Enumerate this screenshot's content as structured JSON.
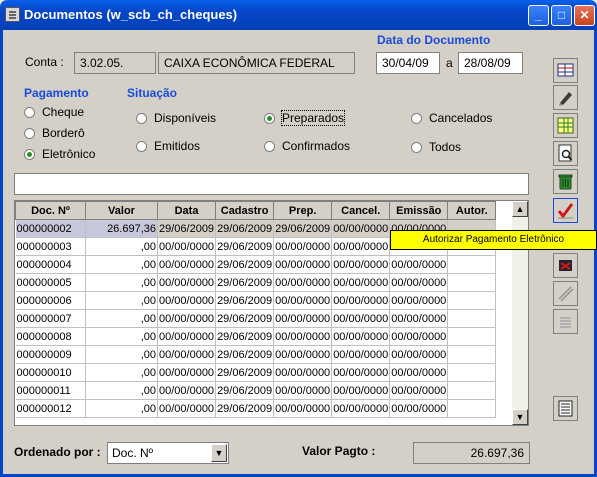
{
  "window": {
    "title": "Documentos (w_scb_ch_cheques)",
    "minimize": "_",
    "maximize": "□",
    "close": "✕"
  },
  "conta": {
    "label": "Conta :",
    "code": "3.02.05.",
    "name": "CAIXA ECONÔMICA FEDERAL"
  },
  "data_documento": {
    "label": "Data do Documento",
    "from": "30/04/09",
    "sep": "a",
    "to": "28/08/09"
  },
  "pagamento": {
    "label": "Pagamento",
    "options": [
      "Cheque",
      "Borderô",
      "Eletrônico"
    ],
    "selected": "Eletrônico"
  },
  "situacao": {
    "label": "Situação",
    "options": [
      "Disponíveis",
      "Preparados",
      "Cancelados",
      "Emitidos",
      "Confirmados",
      "Todos"
    ],
    "selected": "Preparados"
  },
  "table": {
    "columns": [
      "Doc. Nº",
      "Valor",
      "Data",
      "Cadastro",
      "Prep.",
      "Cancel.",
      "Emissão",
      "Autor."
    ],
    "rows": [
      [
        "000000002",
        "26.697,36",
        "29/06/2009",
        "29/06/2009",
        "29/06/2009",
        "00/00/0000",
        "00/00/0000",
        ""
      ],
      [
        "000000003",
        ",00",
        "00/00/0000",
        "29/06/2009",
        "00/00/0000",
        "00/00/0000",
        "00/00/0000",
        ""
      ],
      [
        "000000004",
        ",00",
        "00/00/0000",
        "29/06/2009",
        "00/00/0000",
        "00/00/0000",
        "00/00/0000",
        ""
      ],
      [
        "000000005",
        ",00",
        "00/00/0000",
        "29/06/2009",
        "00/00/0000",
        "00/00/0000",
        "00/00/0000",
        ""
      ],
      [
        "000000006",
        ",00",
        "00/00/0000",
        "29/06/2009",
        "00/00/0000",
        "00/00/0000",
        "00/00/0000",
        ""
      ],
      [
        "000000007",
        ",00",
        "00/00/0000",
        "29/06/2009",
        "00/00/0000",
        "00/00/0000",
        "00/00/0000",
        ""
      ],
      [
        "000000008",
        ",00",
        "00/00/0000",
        "29/06/2009",
        "00/00/0000",
        "00/00/0000",
        "00/00/0000",
        ""
      ],
      [
        "000000009",
        ",00",
        "00/00/0000",
        "29/06/2009",
        "00/00/0000",
        "00/00/0000",
        "00/00/0000",
        ""
      ],
      [
        "000000010",
        ",00",
        "00/00/0000",
        "29/06/2009",
        "00/00/0000",
        "00/00/0000",
        "00/00/0000",
        ""
      ],
      [
        "000000011",
        ",00",
        "00/00/0000",
        "29/06/2009",
        "00/00/0000",
        "00/00/0000",
        "00/00/0000",
        ""
      ],
      [
        "000000012",
        ",00",
        "00/00/0000",
        "29/06/2009",
        "00/00/0000",
        "00/00/0000",
        "00/00/0000",
        ""
      ]
    ]
  },
  "tooltip": "Autorizar Pagamento Eletrônico",
  "ordenado": {
    "label": "Ordenado por :",
    "value": "Doc. Nº"
  },
  "valor_pagto": {
    "label": "Valor Pagto :",
    "value": "26.697,36"
  },
  "toolbar_icons": [
    "select-icon",
    "edit-pen-icon",
    "spreadsheet-icon",
    "print-preview-icon",
    "trash-icon",
    "authorize-check-icon",
    "cut-check-icon",
    "confirm-check-icon",
    "list-icon",
    "report-icon"
  ]
}
